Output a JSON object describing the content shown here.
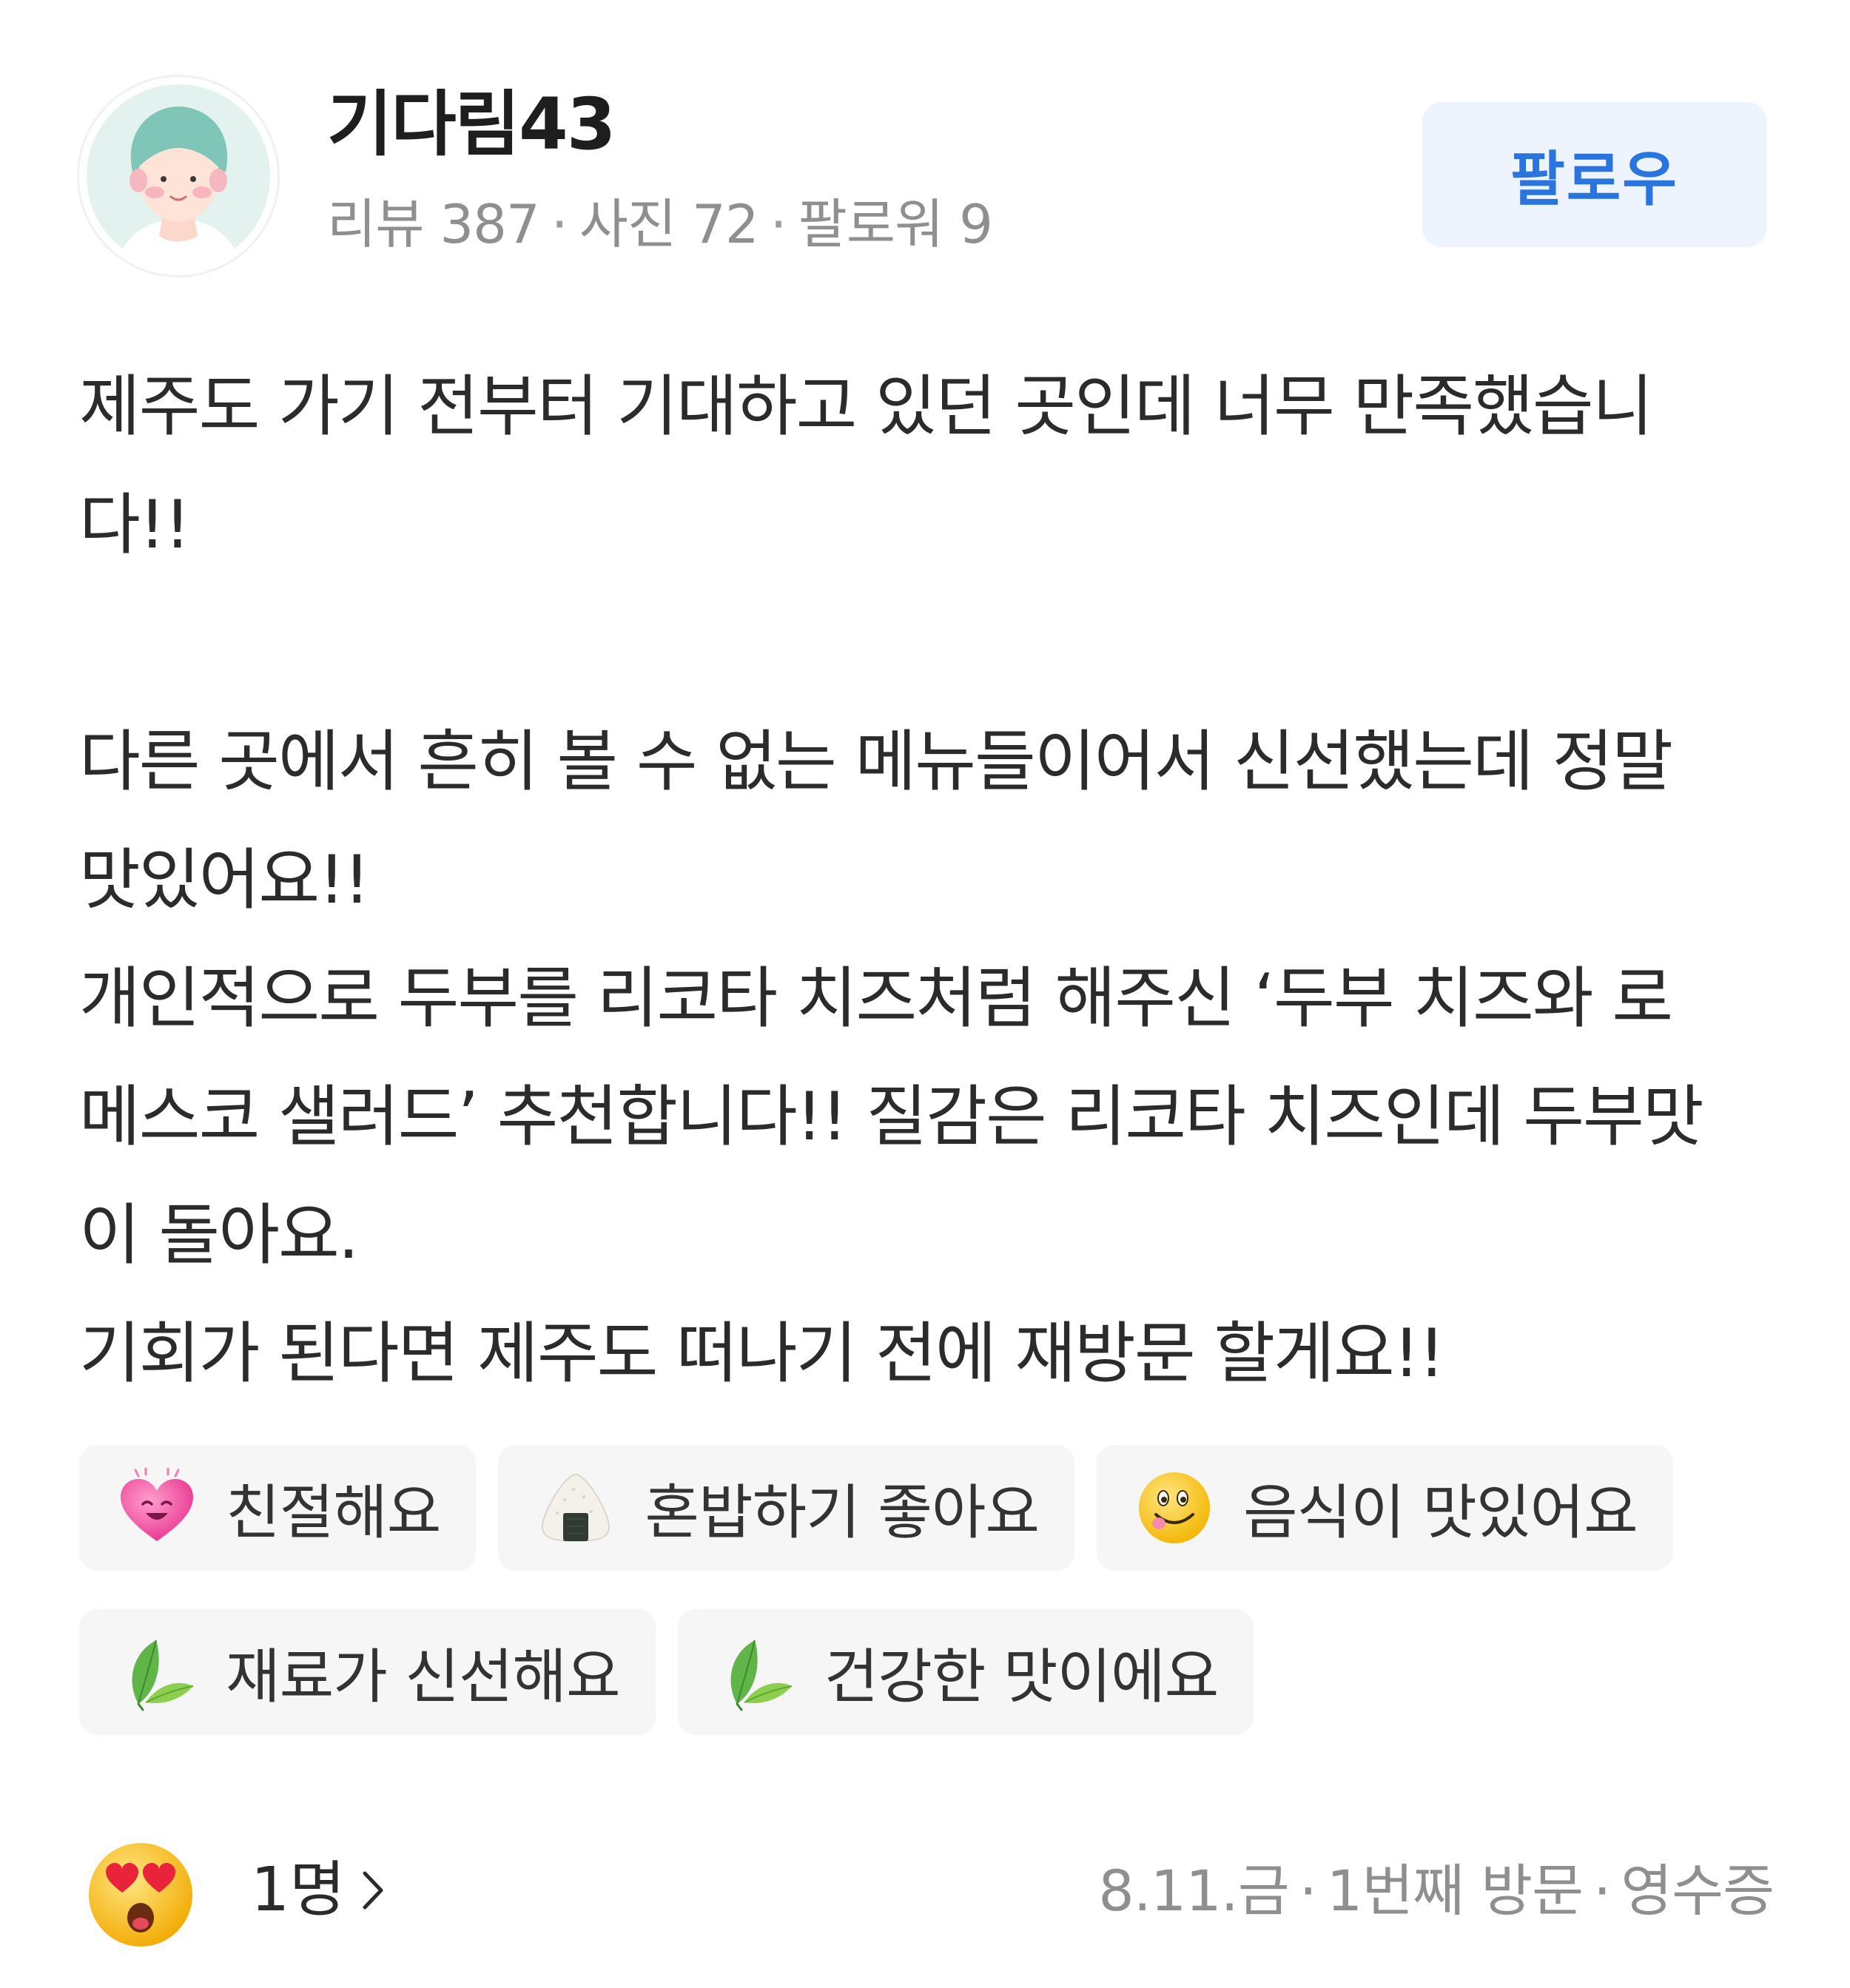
{
  "user": {
    "name": "기다림43",
    "stats": {
      "reviews": "리뷰 387",
      "photos": "사진 72",
      "followers": "팔로워 9"
    },
    "separator": "·"
  },
  "follow_button": {
    "label": "팔로우"
  },
  "review": {
    "lines": [
      "제주도 가기 전부터 기대하고 있던 곳인데 너무 만족했습니",
      "다!!",
      "",
      "다른 곳에서 흔히 볼 수 없는 메뉴들이어서 신선했는데 정말",
      "맛있어요!!",
      "개인적으로 두부를 리코타 치즈처럼 해주신 ‘두부 치즈와 로",
      "메스코 샐러드’ 추천합니다!! 질감은 리코타 치즈인데 두부맛",
      "이 돌아요.",
      "기회가 된다면 제주도 떠나기 전에 재방문 할게요!!"
    ]
  },
  "tags": [
    {
      "label": "친절해요",
      "icon": "smiling-heart-icon"
    },
    {
      "label": "혼밥하기 좋아요",
      "icon": "rice-ball-icon"
    },
    {
      "label": "음식이 맛있어요",
      "icon": "yummy-face-icon"
    },
    {
      "label": "재료가 신선해요",
      "icon": "leaf-icon"
    },
    {
      "label": "건강한 맛이에요",
      "icon": "leaf-icon"
    }
  ],
  "footer": {
    "reaction_icon": "heart-eyes-emoji-icon",
    "reaction_count": "1명",
    "visit_date": "8.11.금",
    "visit_count": "1번째 방문",
    "verification": "영수증",
    "separator": "·"
  },
  "colors": {
    "accent_blue": "#2a74de",
    "follow_bg": "#eef4fd",
    "tag_bg": "#f6f6f6",
    "muted_text": "#8f8f8f",
    "body_text": "#2b2b2b"
  }
}
